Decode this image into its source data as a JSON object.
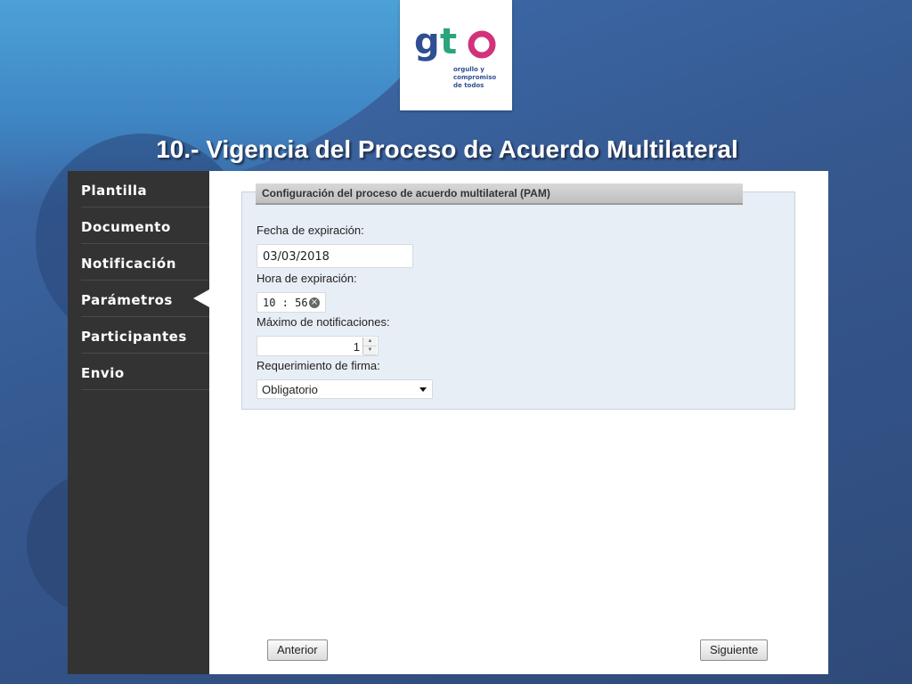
{
  "slide": {
    "title": "10.- Vigencia del Proceso de Acuerdo Multilateral"
  },
  "logo": {
    "brand": "gto",
    "tagline_1": "orgullo y",
    "tagline_2": "compromiso",
    "tagline_3": "de todos"
  },
  "sidebar": {
    "items": [
      {
        "label": "Plantilla"
      },
      {
        "label": "Documento"
      },
      {
        "label": "Notificación"
      },
      {
        "label": "Parámetros",
        "active": true
      },
      {
        "label": "Participantes"
      },
      {
        "label": "Envio"
      }
    ]
  },
  "panel": {
    "header": "Configuración del proceso de acuerdo multilateral (PAM)",
    "fecha_label": "Fecha de expiración:",
    "fecha_value": "03/03/2018",
    "hora_label": "Hora de expiración:",
    "hora_value": "10 : 56",
    "max_label": "Máximo de notificaciones:",
    "max_value": "1",
    "firma_label": "Requerimiento de firma:",
    "firma_value": "Obligatorio"
  },
  "buttons": {
    "anterior": "Anterior",
    "siguiente": "Siguiente"
  },
  "colors": {
    "sidebar_bg": "#333333",
    "panel_bg": "#e8eef5",
    "slide_bg": "#35588f"
  }
}
